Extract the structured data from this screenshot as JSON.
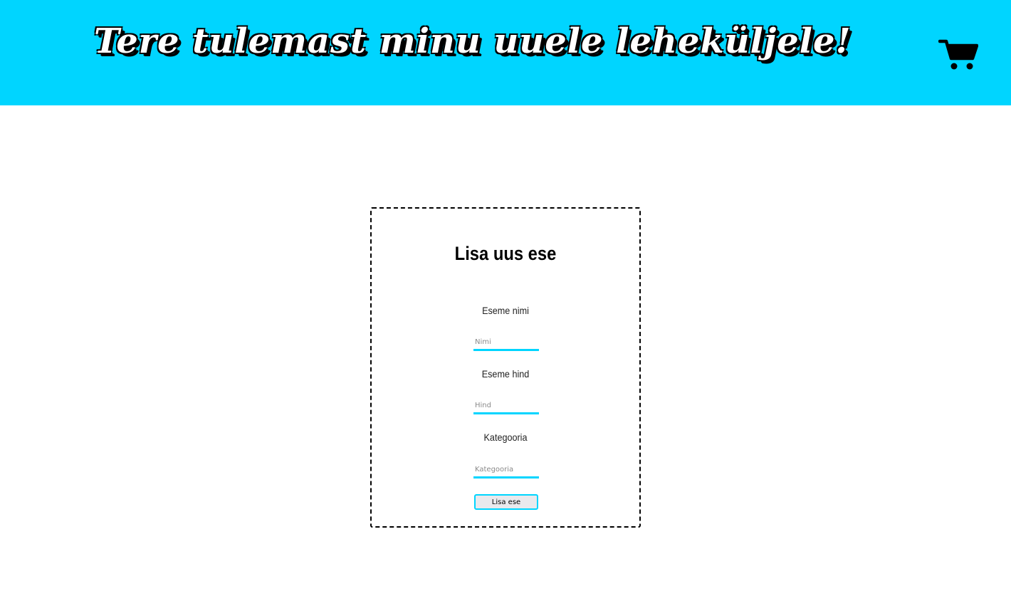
{
  "header": {
    "title": "Tere tulemast minu uuele leheküljele!",
    "cart_icon": "shopping-cart-icon",
    "background_color": "#00d5ff"
  },
  "form": {
    "title": "Lisa uus ese",
    "fields": [
      {
        "label": "Eseme nimi",
        "placeholder": "Nimi",
        "value": ""
      },
      {
        "label": "Eseme hind",
        "placeholder": "Hind",
        "value": ""
      },
      {
        "label": "Kategooria",
        "placeholder": "Kategooria",
        "value": ""
      }
    ],
    "submit_label": "Lisa ese",
    "accent_color": "#00d5ff"
  }
}
